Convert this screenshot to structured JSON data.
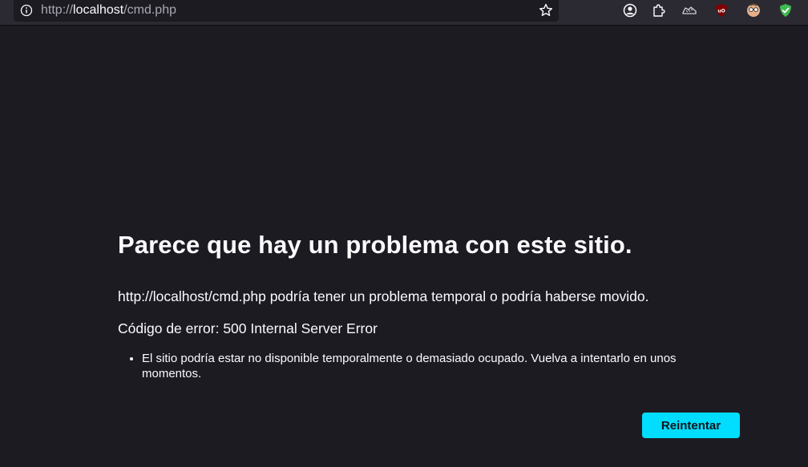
{
  "browser": {
    "url_prefix": "http://",
    "url_host": "localhost",
    "url_path": "/cmd.php",
    "icons": {
      "site_info": "info-icon",
      "bookmark": "star-icon",
      "extensions": [
        "account-icon",
        "puzzle-extensions-icon",
        "shoe-extension-icon",
        "ublock-origin-icon",
        "face-extension-icon",
        "shield-check-icon"
      ]
    },
    "colors": {
      "toolbar": "#2b2a33",
      "page_background": "#1c1b22",
      "accent": "#00ddff"
    }
  },
  "error_page": {
    "title": "Parece que hay un problema con este sitio.",
    "description": "http://localhost/cmd.php podría tener un problema temporal o podría haberse movido.",
    "error_code": "Código de error: 500 Internal Server Error",
    "suggestions": [
      "El sitio podría estar no disponible temporalmente o demasiado ocupado. Vuelva a intentarlo en unos momentos."
    ],
    "retry_label": "Reintentar"
  }
}
